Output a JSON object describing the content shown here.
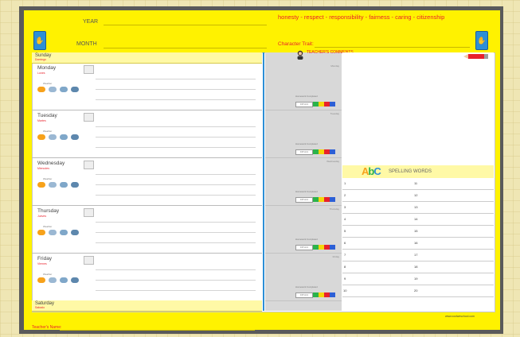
{
  "header": {
    "year_label": "YEAR",
    "month_label": "MONTH",
    "values_text": "honesty - respect - responsibility - fairness - caring - citizenship",
    "character_trait_label": "Character Trait:"
  },
  "week": {
    "days": [
      {
        "name": "Sunday",
        "sub": "Domingo",
        "kind": "band"
      },
      {
        "name": "Monday",
        "sub": "Lunes",
        "kind": "day"
      },
      {
        "name": "Tuesday",
        "sub": "Martes",
        "kind": "day"
      },
      {
        "name": "Wednesday",
        "sub": "Miercoles",
        "kind": "day"
      },
      {
        "name": "Thursday",
        "sub": "Jueves",
        "kind": "day"
      },
      {
        "name": "Friday",
        "sub": "Viernes",
        "kind": "day"
      },
      {
        "name": "Saturday",
        "sub": "Sabado",
        "kind": "band"
      }
    ],
    "weather_label": "Weather",
    "homework_label": "Homework Completed",
    "initials_label": "INITIALS"
  },
  "teacher_comments": "TEACHER'S COMMENTS",
  "spelling": {
    "title": "SPELLING WORDS",
    "abc": "AbC",
    "left_numbers": [
      "1",
      "2",
      "3",
      "4",
      "5",
      "6",
      "7",
      "8",
      "9",
      "10"
    ],
    "right_numbers": [
      "11",
      "12",
      "13",
      "14",
      "15",
      "16",
      "17",
      "18",
      "19",
      "20"
    ]
  },
  "footer": {
    "website": "www.coolweschool.com",
    "teacher_name_label": "Teacher's Name:"
  },
  "colors": {
    "sheet": "#fff200",
    "accent_blue": "#2d8fd6",
    "accent_red": "#e8212b"
  }
}
